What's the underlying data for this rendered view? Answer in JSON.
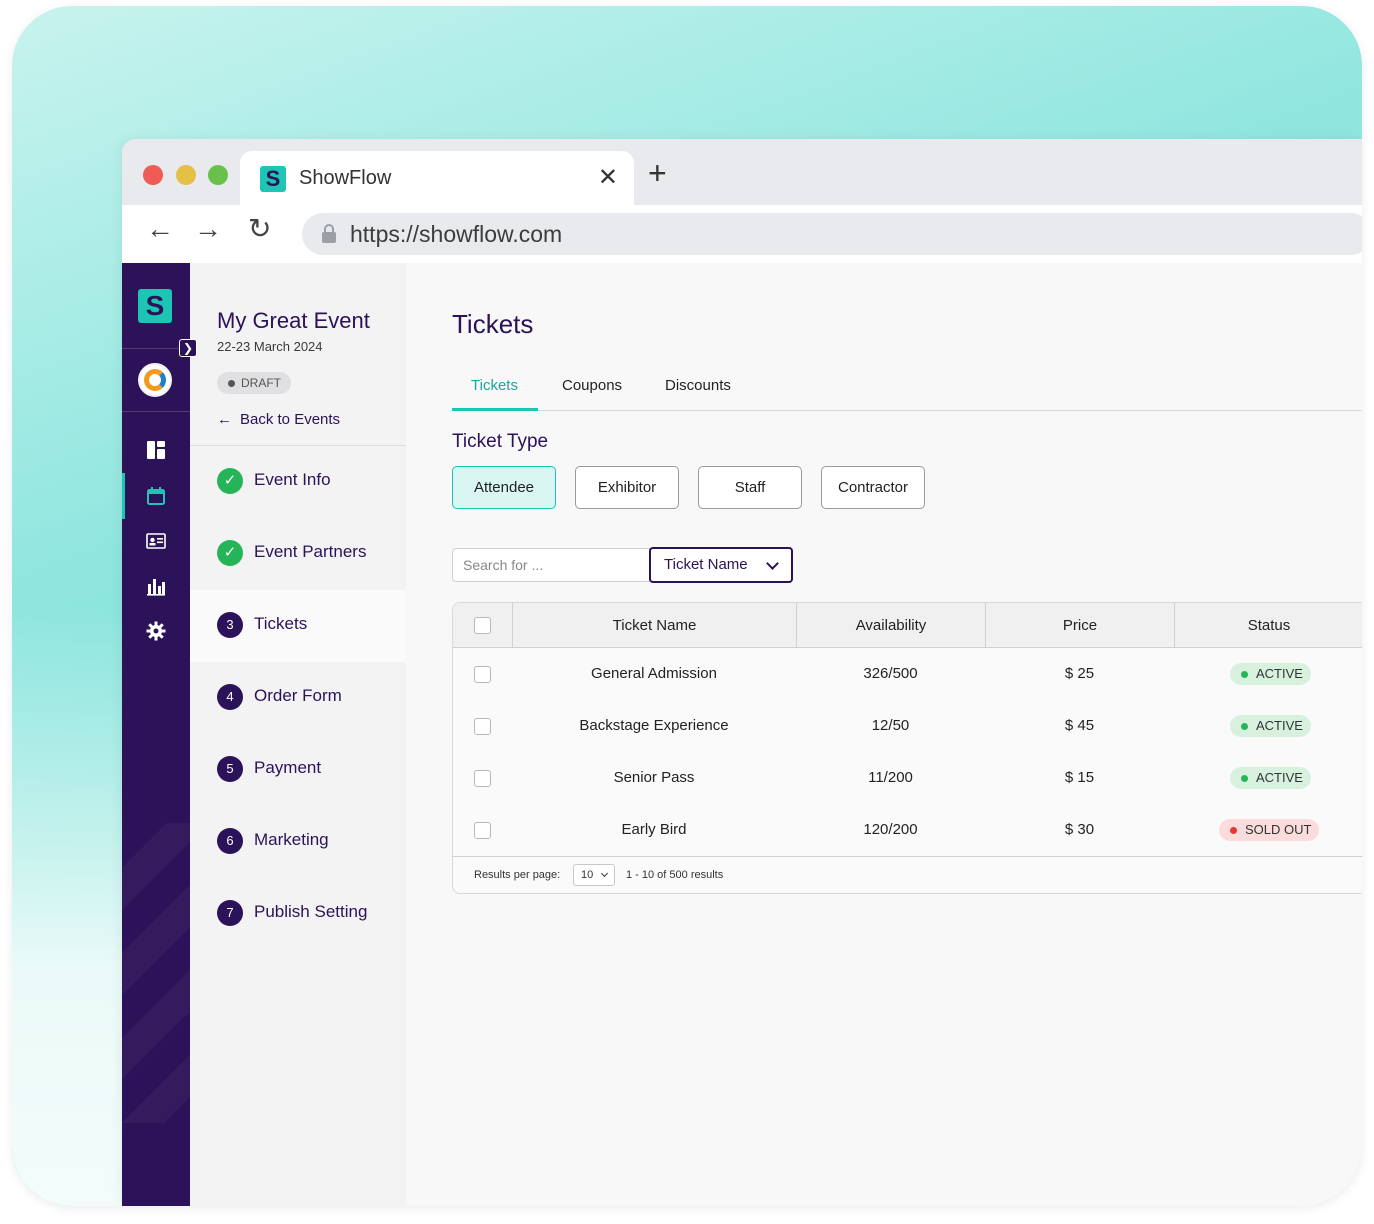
{
  "browser": {
    "tab_title": "ShowFlow",
    "tab_logo_letter": "S",
    "tab_close": "✕",
    "new_tab": "+",
    "url": "https://showflow.com",
    "nav": {
      "back": "←",
      "forward": "→",
      "reload": "↻"
    }
  },
  "rail": {
    "logo_letter": "S",
    "collapse": "❯",
    "icons": [
      "dashboard-icon",
      "calendar-icon",
      "badge-icon",
      "chart-icon",
      "gear-icon"
    ],
    "active_icon": "calendar-icon"
  },
  "sidebar": {
    "event_title": "My Great Event",
    "event_date": "22-23 March 2024",
    "status_badge": "DRAFT",
    "back_link": "Back to Events",
    "back_arrow": "←",
    "steps": [
      {
        "badge": "✓",
        "label": "Event Info",
        "state": "done"
      },
      {
        "badge": "✓",
        "label": "Event Partners",
        "state": "done"
      },
      {
        "badge": "3",
        "label": "Tickets",
        "state": "active"
      },
      {
        "badge": "4",
        "label": "Order Form",
        "state": "todo"
      },
      {
        "badge": "5",
        "label": "Payment",
        "state": "todo"
      },
      {
        "badge": "6",
        "label": "Marketing",
        "state": "todo"
      },
      {
        "badge": "7",
        "label": "Publish Setting",
        "state": "todo"
      }
    ]
  },
  "main": {
    "title": "Tickets",
    "tabs": [
      {
        "label": "Tickets",
        "active": true
      },
      {
        "label": "Coupons",
        "active": false
      },
      {
        "label": "Discounts",
        "active": false
      }
    ],
    "ticket_type_title": "Ticket Type",
    "ticket_types": [
      {
        "label": "Attendee",
        "active": true
      },
      {
        "label": "Exhibitor",
        "active": false
      },
      {
        "label": "Staff",
        "active": false
      },
      {
        "label": "Contractor",
        "active": false
      }
    ],
    "search": {
      "placeholder": "Search for ...",
      "filter_label": "Ticket Name"
    },
    "table": {
      "headers": [
        "Ticket Name",
        "Availability",
        "Price",
        "Status"
      ],
      "rows": [
        {
          "name": "General Admission",
          "availability": "326/500",
          "price": "$ 25",
          "status": "ACTIVE"
        },
        {
          "name": "Backstage Experience",
          "availability": "12/50",
          "price": "$ 45",
          "status": "ACTIVE"
        },
        {
          "name": "Senior Pass",
          "availability": "11/200",
          "price": "$ 15",
          "status": "ACTIVE"
        },
        {
          "name": "Early Bird",
          "availability": "120/200",
          "price": "$ 30",
          "status": "SOLD OUT"
        }
      ],
      "footer": {
        "per_page_label": "Results per page:",
        "per_page_value": "10",
        "range": "1 - 10 of 500 results"
      }
    }
  },
  "colors": {
    "brand_purple": "#2c1258",
    "brand_teal": "#1cc5b4",
    "active_green": "#25b457",
    "sold_red": "#e53935"
  }
}
